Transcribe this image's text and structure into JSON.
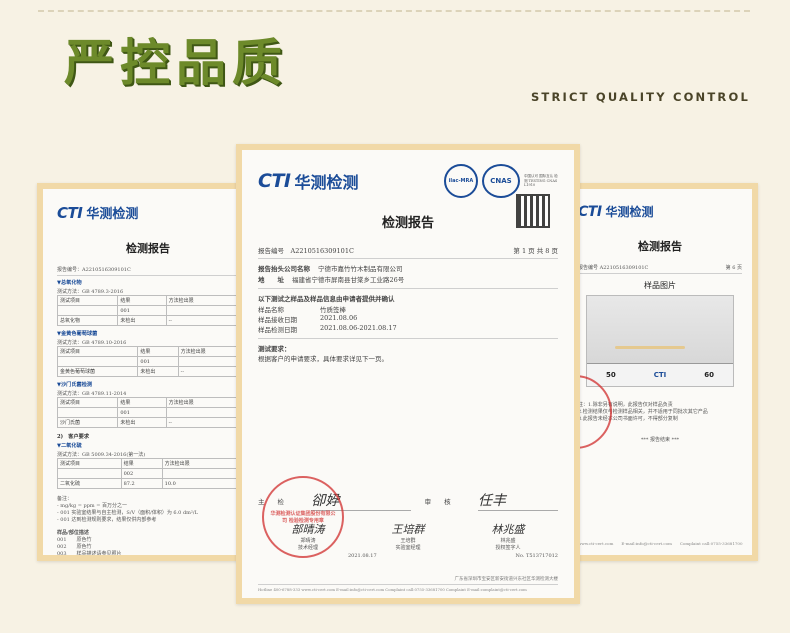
{
  "header": {
    "title": "严控品质",
    "subtitle": "STRICT QUALITY CONTROL"
  },
  "logo": {
    "cti": "CTI",
    "cn": "华测检测"
  },
  "center_doc": {
    "heading": "检测报告",
    "report_no_label": "报告编号",
    "report_no": "A2210516309101C",
    "page_info": "第 1 页 共 8 页",
    "client_label": "报告抬头公司名称",
    "client_value": "宁德市嘉竹竹木制品有限公司",
    "address_label": "地　　址",
    "address_value": "福建省宁德市屏南县甘棠乡工业路26号",
    "confirm_heading": "以下测试之样品及样品信息由申请者提供并确认",
    "rows": [
      {
        "label": "样品名称",
        "value": "竹质签棒"
      },
      {
        "label": "样品接收日期",
        "value": "2021.08.06"
      },
      {
        "label": "样品检测日期",
        "value": "2021.08.06-2021.08.17"
      }
    ],
    "test_req_label": "测试要求：",
    "test_req_value": "根据客户的申请要求，具体要求详见下一页。",
    "sign": {
      "chief_label": "主　　检",
      "chief_sig": "卻㚺",
      "audit_label": "审　　核",
      "audit_sig": "任丰",
      "signers": [
        {
          "sig": "部晴涛",
          "name": "郑晴涛",
          "role": "技术经理"
        },
        {
          "sig": "王培群",
          "name": "王培群",
          "role": "实验室经理"
        },
        {
          "sig": "林兆盛",
          "name": "林兆盛",
          "role": "授权签字人"
        }
      ],
      "date": "2021.08.17",
      "no": "No. T513717012"
    },
    "stamp_text": "华测检测认证集团股份有限公司 检验检测专用章",
    "certs": [
      "ilac-MRA",
      "CNAS",
      "中国认可 国际互认 检测 TESTING CNAS L1910"
    ],
    "footer_addr": "广东省深圳市宝安区新安街道兴东社区华测检测大楼",
    "footer_contacts": "Hotline 400-6788-333    www.cti-cert.com    E-mail:info@cti-cert.com    Complaint call:0755-33681700    Complaint E-mail:complaint@cti-cert.com"
  },
  "left_doc": {
    "heading": "检测报告",
    "report_no": "报告编号：A2210516309101C",
    "sections": [
      {
        "title": "▼总氧化物",
        "method": "测试方法：GB 4789.3-2016",
        "rows": [
          [
            "测试项目",
            "结果",
            "方法检出限"
          ],
          [
            "",
            "001",
            ""
          ],
          [
            "总氧化物",
            "未检出",
            "--"
          ]
        ]
      },
      {
        "title": "▼金黄色葡萄球菌",
        "method": "测试方法：GB 4789.10-2016",
        "rows": [
          [
            "测试项目",
            "结果",
            "方法检出限"
          ],
          [
            "",
            "001",
            ""
          ],
          [
            "金黄色葡萄球菌",
            "未检出",
            "--"
          ]
        ]
      },
      {
        "title": "▼沙门氏菌检测",
        "method": "测试方法：GB 4789.11-2014",
        "rows": [
          [
            "测试项目",
            "结果",
            "方法检出限"
          ],
          [
            "",
            "001",
            ""
          ],
          [
            "沙门氏菌",
            "未检出",
            "--"
          ]
        ]
      }
    ],
    "sec2_title": "2)　客户要求",
    "sec2_sub": "▼二氧化硫",
    "sec2_method": "测试方法：GB 5009.34-2016(第一法)",
    "sec2_rows": [
      [
        "测试项目",
        "结果",
        "方法检出限"
      ],
      [
        "",
        "002",
        ""
      ],
      [
        "二氧化硫",
        "87.2",
        "10.0"
      ]
    ],
    "notes_title": "备注：",
    "notes": [
      "- mg/kg = ppm = 百万分之一",
      "- 001 实验室结果与自主检测，S/V（面积/体积）为 6.0 dm²/L",
      "- 001 达到检测规则要求，结果仅供内部参考"
    ],
    "samples_title": "样品/部位描述",
    "samples": [
      "001　　原色竹",
      "002　　原色竹",
      "003　　样品描述请参见照片"
    ]
  },
  "right_doc": {
    "heading": "检测报告",
    "page_info": "第 6 页",
    "report_no": "报告编号 A2210516309101C",
    "photo_heading": "样品图片",
    "ruler_labels": [
      "50",
      "CTI",
      "60"
    ],
    "notes": [
      "注：1.除非另有说明，此报告仅对样品负责",
      "2.检测结果仅与检测样品相关，并不适用于同批次其它产品",
      "3.此报告未经本公司书面许可，不得部分复制"
    ],
    "end_text": "*** 报告结束 ***",
    "footer": "www.cti-cert.com　　E-mail:info@cti-cert.com　　Complaint call:0755-33681700"
  }
}
